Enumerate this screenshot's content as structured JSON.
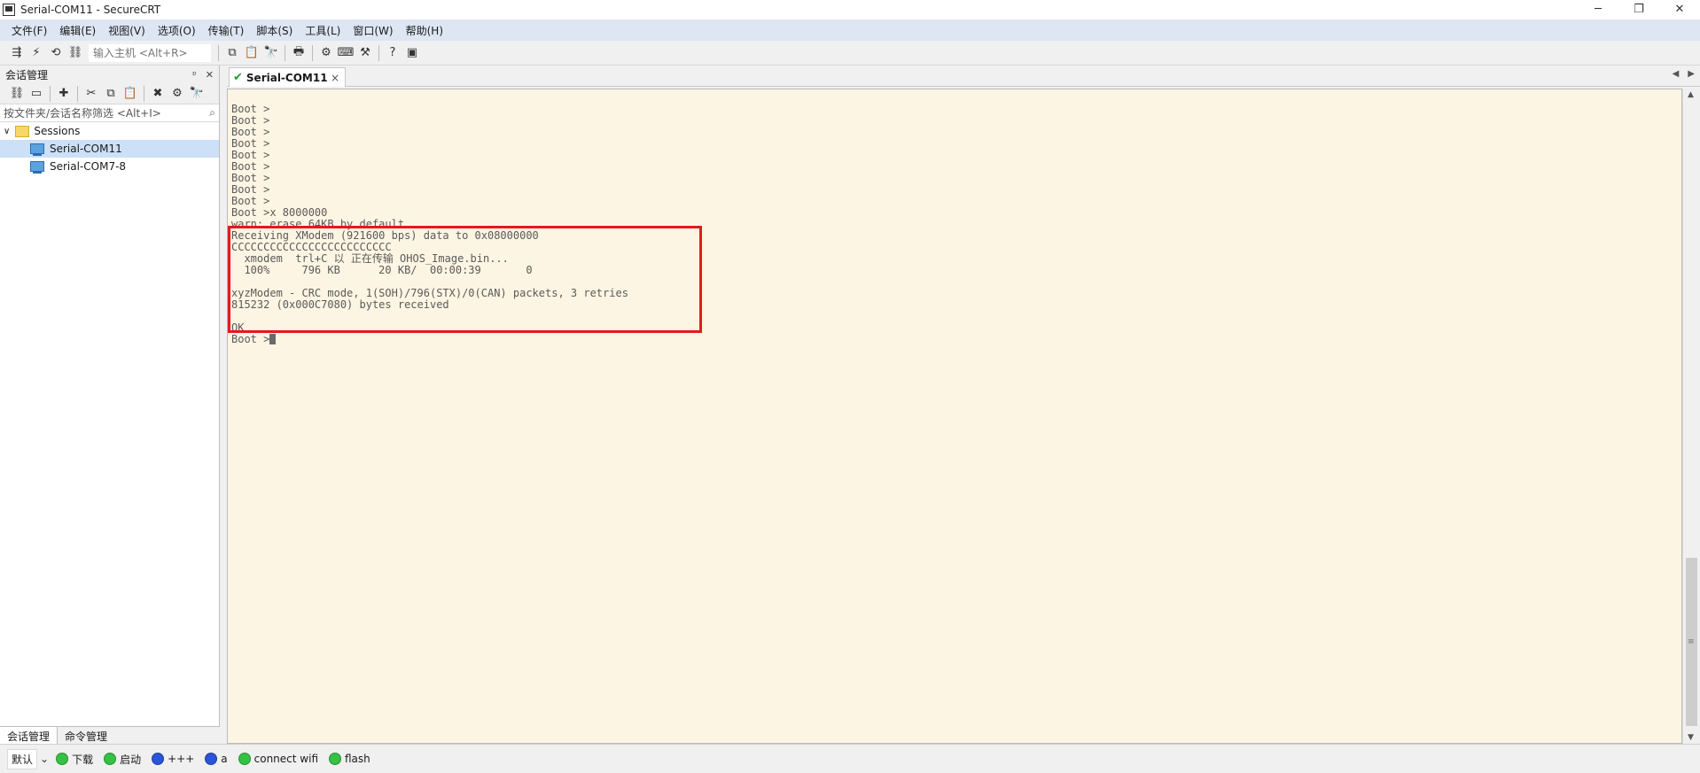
{
  "window": {
    "title": "Serial-COM11 - SecureCRT",
    "controls": [
      "─",
      "❐",
      "✕"
    ]
  },
  "menu": [
    "文件(F)",
    "编辑(E)",
    "视图(V)",
    "选项(O)",
    "传输(T)",
    "脚本(S)",
    "工具(L)",
    "窗口(W)",
    "帮助(H)"
  ],
  "toolbar": {
    "host_placeholder": "输入主机 <Alt+R>"
  },
  "session_manager": {
    "title": "会话管理",
    "pin": "ᵖ",
    "close": "✕",
    "filter_placeholder": "按文件夹/会话名称筛选 <Alt+I>",
    "root": "Sessions",
    "sessions": [
      "Serial-COM11",
      "Serial-COM7-8"
    ],
    "bottom_tabs": [
      "会话管理",
      "命令管理"
    ]
  },
  "tab": {
    "label": "Serial-COM11",
    "close": "×"
  },
  "terminal": {
    "lines": [
      "Boot >",
      "Boot >",
      "Boot >",
      "Boot >",
      "Boot >",
      "Boot >",
      "Boot >",
      "Boot >",
      "Boot >",
      "Boot >x 8000000",
      "warn: erase 64KB by default",
      "Receiving XModem (921600 bps) data to 0x08000000",
      "CCCCCCCCCCCCCCCCCCCCCCCCC",
      "  xmodem  trl+C 以 正在传输 OHOS_Image.bin...",
      "  100%     796 KB      20 KB/  00:00:39       0",
      "",
      "xyzModem - CRC mode, 1(SOH)/796(STX)/0(CAN) packets, 3 retries",
      "815232 (0x000C7080) bytes received",
      "",
      "OK"
    ],
    "prompt": "Boot >"
  },
  "button_bar": {
    "label": "默认",
    "buttons": [
      {
        "label": "下载",
        "color": "#35c244"
      },
      {
        "label": "启动",
        "color": "#35c244"
      },
      {
        "label": "+++",
        "color": "#2a55d8"
      },
      {
        "label": "a",
        "color": "#2a55d8"
      },
      {
        "label": "connect wifi",
        "color": "#35c244"
      },
      {
        "label": "flash",
        "color": "#35c244"
      }
    ]
  },
  "colors": {
    "terminal_bg": "#fdf5e3",
    "highlight": "#e01b1b",
    "menubar_bg": "#dde6f2"
  }
}
